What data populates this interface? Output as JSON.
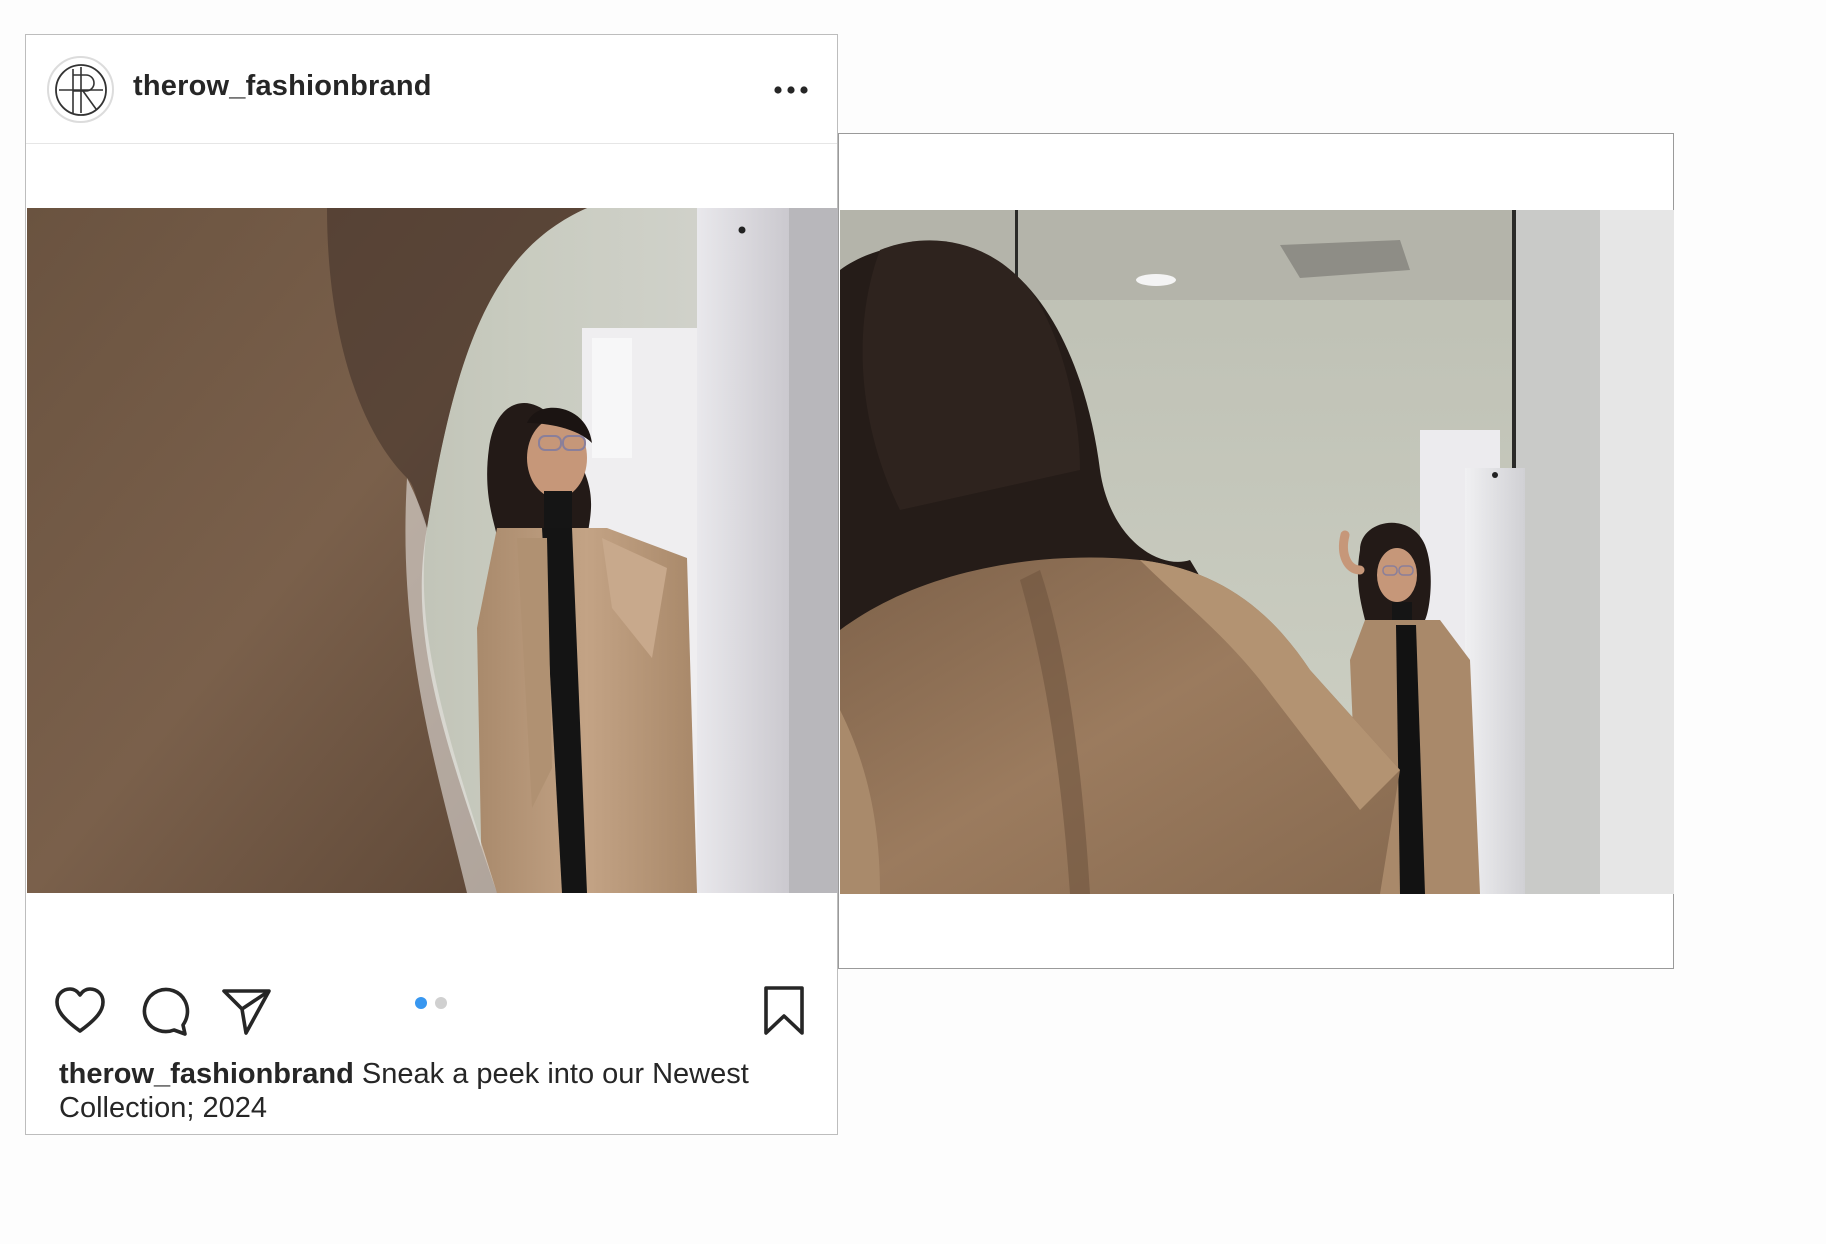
{
  "post": {
    "username": "therow_fashionbrand",
    "avatar_icon": "brand-monogram-icon",
    "more_icon": "more-options-icon",
    "actions": {
      "like_icon": "heart-icon",
      "comment_icon": "comment-icon",
      "share_icon": "send-icon",
      "save_icon": "bookmark-icon"
    },
    "carousel": {
      "slides": 2,
      "active_index": 1,
      "active_color": "#3897f0",
      "inactive_color": "#d0d0d0"
    },
    "caption": {
      "user": "therow_fashionbrand",
      "text": " Sneak a peek into our Newest Collection; 2024"
    }
  },
  "colors": {
    "text": "#262626",
    "border": "#bdbdbd",
    "coat_tan": "#b89474",
    "background": "#fdfdfd"
  }
}
